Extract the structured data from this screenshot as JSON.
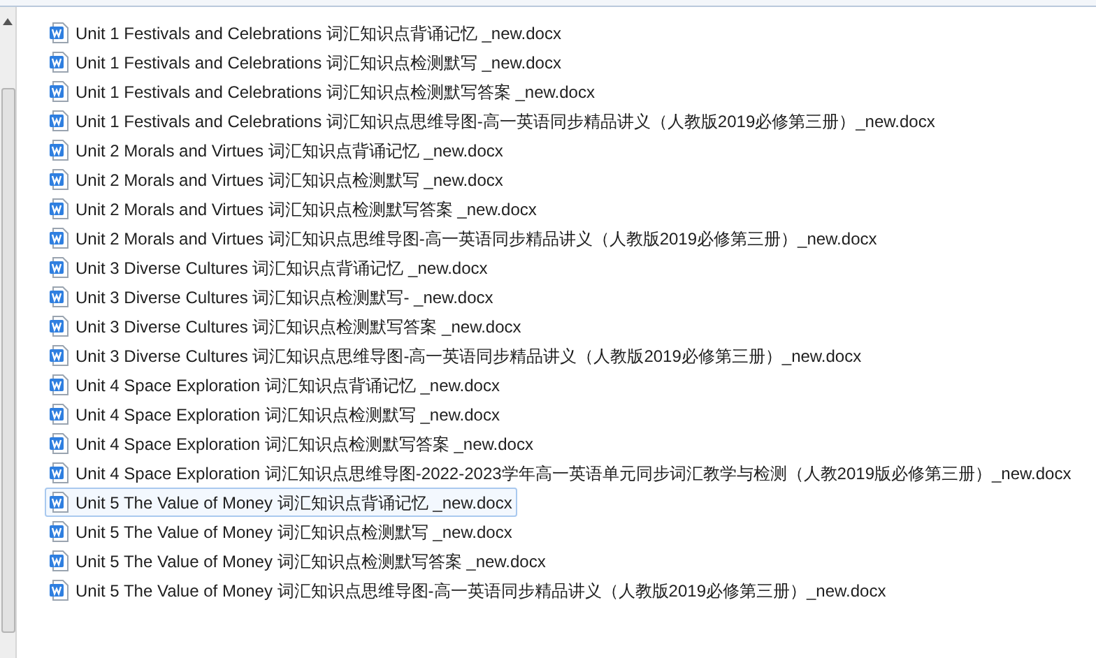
{
  "files": [
    {
      "name": "Unit 1 Festivals and Celebrations 词汇知识点背诵记忆 _new.docx",
      "selected": false
    },
    {
      "name": "Unit 1 Festivals and Celebrations 词汇知识点检测默写  _new.docx",
      "selected": false
    },
    {
      "name": "Unit 1 Festivals and Celebrations 词汇知识点检测默写答案 _new.docx",
      "selected": false
    },
    {
      "name": "Unit 1 Festivals and Celebrations 词汇知识点思维导图-高一英语同步精品讲义（人教版2019必修第三册）_new.docx",
      "selected": false
    },
    {
      "name": "Unit 2 Morals and Virtues 词汇知识点背诵记忆  _new.docx",
      "selected": false
    },
    {
      "name": "Unit 2 Morals and Virtues 词汇知识点检测默写 _new.docx",
      "selected": false
    },
    {
      "name": "Unit 2 Morals and Virtues 词汇知识点检测默写答案  _new.docx",
      "selected": false
    },
    {
      "name": "Unit 2 Morals and Virtues 词汇知识点思维导图-高一英语同步精品讲义（人教版2019必修第三册）_new.docx",
      "selected": false
    },
    {
      "name": "Unit 3 Diverse Cultures 词汇知识点背诵记忆 _new.docx",
      "selected": false
    },
    {
      "name": "Unit 3 Diverse Cultures 词汇知识点检测默写-  _new.docx",
      "selected": false
    },
    {
      "name": "Unit 3 Diverse Cultures 词汇知识点检测默写答案 _new.docx",
      "selected": false
    },
    {
      "name": "Unit 3 Diverse Cultures 词汇知识点思维导图-高一英语同步精品讲义（人教版2019必修第三册）_new.docx",
      "selected": false
    },
    {
      "name": "Unit 4 Space Exploration 词汇知识点背诵记忆  _new.docx",
      "selected": false
    },
    {
      "name": "Unit 4 Space Exploration 词汇知识点检测默写 _new.docx",
      "selected": false
    },
    {
      "name": "Unit 4 Space Exploration 词汇知识点检测默写答案 _new.docx",
      "selected": false
    },
    {
      "name": "Unit 4 Space Exploration 词汇知识点思维导图-2022-2023学年高一英语单元同步词汇教学与检测（人教2019版必修第三册）_new.docx",
      "selected": false
    },
    {
      "name": "Unit 5 The Value of Money 词汇知识点背诵记忆 _new.docx",
      "selected": true
    },
    {
      "name": "Unit 5 The Value of Money 词汇知识点检测默写  _new.docx",
      "selected": false
    },
    {
      "name": "Unit 5 The Value of Money 词汇知识点检测默写答案 _new.docx",
      "selected": false
    },
    {
      "name": "Unit 5 The Value of Money 词汇知识点思维导图-高一英语同步精品讲义（人教版2019必修第三册）_new.docx",
      "selected": false
    }
  ]
}
